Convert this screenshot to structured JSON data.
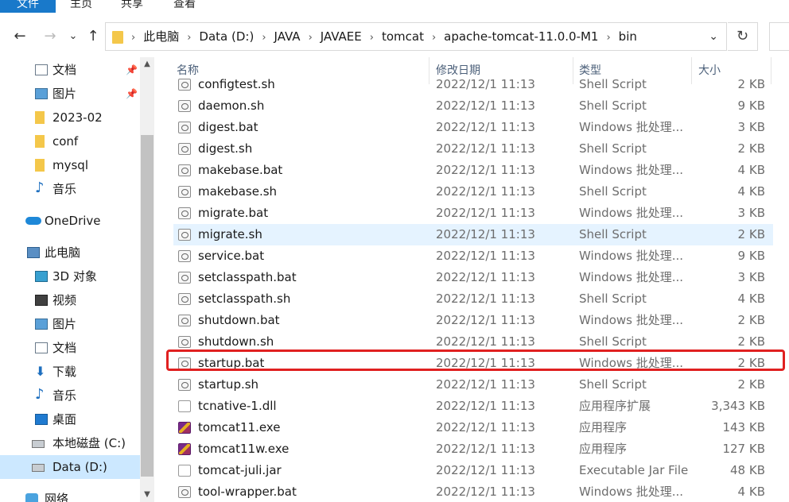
{
  "ribbon": {
    "tabs": [
      "文件",
      "主页",
      "共享",
      "查看"
    ]
  },
  "nav": {
    "back_icon": "←",
    "forward_icon": "→",
    "recent_icon": "⌄",
    "up_icon": "↑",
    "breadcrumbs": [
      "此电脑",
      "Data (D:)",
      "JAVA",
      "JAVAEE",
      "tomcat",
      "apache-tomcat-11.0.0-M1",
      "bin"
    ],
    "dropdown_icon": "⌄",
    "refresh_icon": "↻"
  },
  "sidebar": {
    "items": [
      {
        "label": "文档",
        "icon": "document-icon",
        "pinned": true
      },
      {
        "label": "图片",
        "icon": "pictures-icon",
        "pinned": true
      },
      {
        "label": "2023-02",
        "icon": "folder-icon",
        "pinned": false
      },
      {
        "label": "conf",
        "icon": "folder-icon",
        "pinned": false
      },
      {
        "label": "mysql",
        "icon": "folder-icon",
        "pinned": false
      },
      {
        "label": "音乐",
        "icon": "music-icon",
        "pinned": false
      },
      {
        "label": "OneDrive",
        "icon": "cloud-icon",
        "pinned": false
      },
      {
        "label": "此电脑",
        "icon": "computer-icon",
        "pinned": false
      },
      {
        "label": "3D 对象",
        "icon": "3d-objects-icon",
        "pinned": false
      },
      {
        "label": "视频",
        "icon": "video-icon",
        "pinned": false
      },
      {
        "label": "图片",
        "icon": "pictures-icon",
        "pinned": false
      },
      {
        "label": "文档",
        "icon": "document-icon",
        "pinned": false
      },
      {
        "label": "下载",
        "icon": "download-icon",
        "pinned": false
      },
      {
        "label": "音乐",
        "icon": "music-icon",
        "pinned": false
      },
      {
        "label": "桌面",
        "icon": "desktop-icon",
        "pinned": false
      },
      {
        "label": "本地磁盘 (C:)",
        "icon": "drive-icon",
        "pinned": false
      },
      {
        "label": "Data (D:)",
        "icon": "drive-icon",
        "pinned": false,
        "selected": true
      },
      {
        "label": "网络",
        "icon": "network-icon",
        "pinned": false
      }
    ]
  },
  "columns": {
    "name": "名称",
    "date": "修改日期",
    "type": "类型",
    "size": "大小"
  },
  "files": [
    {
      "name": "configtest.sh",
      "date": "2022/12/1 11:13",
      "type": "Shell Script",
      "size": "2 KB"
    },
    {
      "name": "daemon.sh",
      "date": "2022/12/1 11:13",
      "type": "Shell Script",
      "size": "9 KB"
    },
    {
      "name": "digest.bat",
      "date": "2022/12/1 11:13",
      "type": "Windows 批处理...",
      "size": "3 KB"
    },
    {
      "name": "digest.sh",
      "date": "2022/12/1 11:13",
      "type": "Shell Script",
      "size": "2 KB"
    },
    {
      "name": "makebase.bat",
      "date": "2022/12/1 11:13",
      "type": "Windows 批处理...",
      "size": "4 KB"
    },
    {
      "name": "makebase.sh",
      "date": "2022/12/1 11:13",
      "type": "Shell Script",
      "size": "4 KB"
    },
    {
      "name": "migrate.bat",
      "date": "2022/12/1 11:13",
      "type": "Windows 批处理...",
      "size": "3 KB"
    },
    {
      "name": "migrate.sh",
      "date": "2022/12/1 11:13",
      "type": "Shell Script",
      "size": "2 KB"
    },
    {
      "name": "service.bat",
      "date": "2022/12/1 11:13",
      "type": "Windows 批处理...",
      "size": "9 KB"
    },
    {
      "name": "setclasspath.bat",
      "date": "2022/12/1 11:13",
      "type": "Windows 批处理...",
      "size": "3 KB"
    },
    {
      "name": "setclasspath.sh",
      "date": "2022/12/1 11:13",
      "type": "Shell Script",
      "size": "4 KB"
    },
    {
      "name": "shutdown.bat",
      "date": "2022/12/1 11:13",
      "type": "Windows 批处理...",
      "size": "2 KB"
    },
    {
      "name": "shutdown.sh",
      "date": "2022/12/1 11:13",
      "type": "Shell Script",
      "size": "2 KB"
    },
    {
      "name": "startup.bat",
      "date": "2022/12/1 11:13",
      "type": "Windows 批处理...",
      "size": "2 KB"
    },
    {
      "name": "startup.sh",
      "date": "2022/12/1 11:13",
      "type": "Shell Script",
      "size": "2 KB"
    },
    {
      "name": "tcnative-1.dll",
      "date": "2022/12/1 11:13",
      "type": "应用程序扩展",
      "size": "3,343 KB"
    },
    {
      "name": "tomcat11.exe",
      "date": "2022/12/1 11:13",
      "type": "应用程序",
      "size": "143 KB"
    },
    {
      "name": "tomcat11w.exe",
      "date": "2022/12/1 11:13",
      "type": "应用程序",
      "size": "127 KB"
    },
    {
      "name": "tomcat-juli.jar",
      "date": "2022/12/1 11:13",
      "type": "Executable Jar File",
      "size": "48 KB"
    },
    {
      "name": "tool-wrapper.bat",
      "date": "2022/12/1 11:13",
      "type": "Windows 批处理...",
      "size": "4 KB"
    }
  ],
  "colors": {
    "accent": "#1979ca",
    "hover_row": "#e5f3ff",
    "selected_sidebar": "#cce8ff",
    "annotation_box": "#e02020"
  }
}
